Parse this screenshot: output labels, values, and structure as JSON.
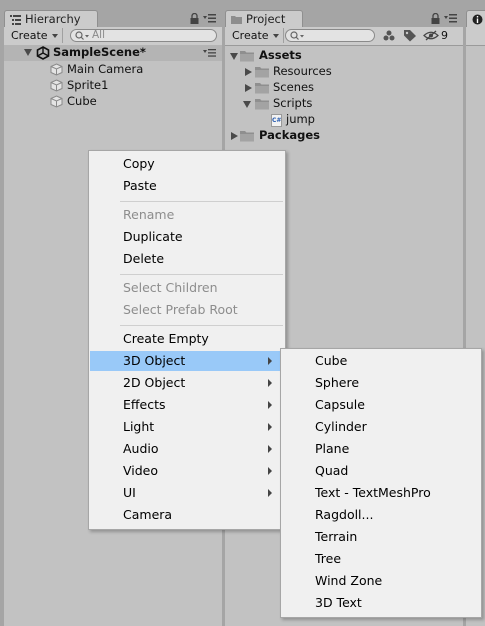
{
  "hierarchy": {
    "tab_label": "Hierarchy",
    "create_label": "Create",
    "search_placeholder": "All",
    "scene_name": "SampleScene*",
    "objects": [
      "Main Camera",
      "Sprite1",
      "Cube"
    ]
  },
  "project": {
    "tab_label": "Project",
    "create_label": "Create",
    "hidden_count": "9",
    "tree": {
      "assets": "Assets",
      "assets_children": [
        "Resources",
        "Scenes",
        "Scripts"
      ],
      "script_file": "jump",
      "script_icon_text": "C#",
      "packages": "Packages"
    }
  },
  "inspector": {
    "tab_icon": "info-icon"
  },
  "context_menu": {
    "items": [
      {
        "label": "Copy",
        "enabled": true
      },
      {
        "label": "Paste",
        "enabled": true
      },
      {
        "label": "Rename",
        "enabled": false
      },
      {
        "label": "Duplicate",
        "enabled": true
      },
      {
        "label": "Delete",
        "enabled": true
      },
      {
        "label": "Select Children",
        "enabled": false
      },
      {
        "label": "Select Prefab Root",
        "enabled": false
      },
      {
        "label": "Create Empty",
        "enabled": true
      },
      {
        "label": "3D Object",
        "enabled": true,
        "submenu": true,
        "highlighted": true
      },
      {
        "label": "2D Object",
        "enabled": true,
        "submenu": true
      },
      {
        "label": "Effects",
        "enabled": true,
        "submenu": true
      },
      {
        "label": "Light",
        "enabled": true,
        "submenu": true
      },
      {
        "label": "Audio",
        "enabled": true,
        "submenu": true
      },
      {
        "label": "Video",
        "enabled": true,
        "submenu": true
      },
      {
        "label": "UI",
        "enabled": true,
        "submenu": true
      },
      {
        "label": "Camera",
        "enabled": true
      }
    ]
  },
  "submenu_3d": {
    "items": [
      "Cube",
      "Sphere",
      "Capsule",
      "Cylinder",
      "Plane",
      "Quad",
      "Text - TextMeshPro",
      "Ragdoll...",
      "Terrain",
      "Tree",
      "Wind Zone",
      "3D Text"
    ]
  },
  "colors": {
    "highlight": "#99c9f8",
    "panel_bg": "#c2c2c2",
    "menu_bg": "#f0f0f0",
    "disabled_text": "#8d8d8d"
  }
}
